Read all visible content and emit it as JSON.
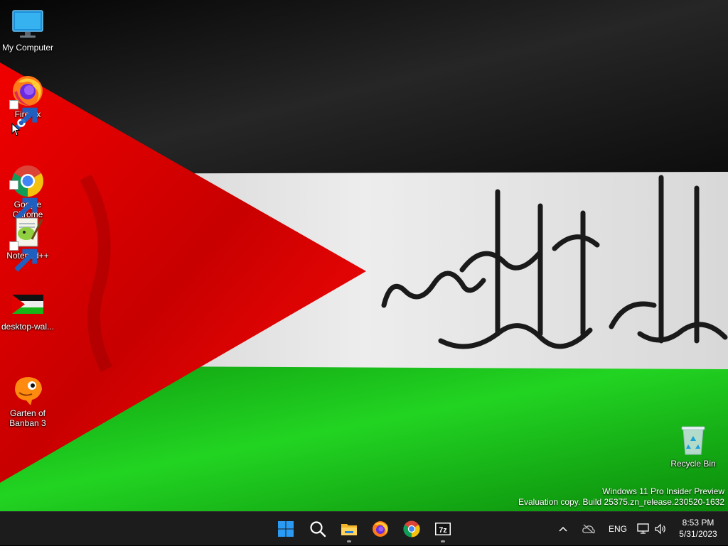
{
  "desktop": {
    "icons": [
      {
        "label": "My Computer",
        "icon": "monitor-icon"
      },
      {
        "label": "Firefox",
        "icon": "firefox-icon",
        "shortcut": true
      },
      {
        "label": "Google\nChrome",
        "icon": "chrome-icon",
        "shortcut": true
      },
      {
        "label": "Notepad++",
        "icon": "notepadpp-icon",
        "shortcut": true
      },
      {
        "label": "desktop-wal...",
        "icon": "image-file-icon"
      },
      {
        "label": "Garten of\nBanban 3",
        "icon": "game-icon"
      },
      {
        "label": "Recycle Bin",
        "icon": "recycle-bin-icon"
      }
    ],
    "watermark": {
      "line1": "Windows 11 Pro Insider Preview",
      "line2": "Evaluation copy. Build 25375.zn_release.230520-1632"
    }
  },
  "taskbar": {
    "apps": [
      {
        "name": "Start",
        "icon": "windows-logo-icon"
      },
      {
        "name": "Search",
        "icon": "search-icon"
      },
      {
        "name": "File Explorer",
        "icon": "folder-icon",
        "running": true
      },
      {
        "name": "Firefox",
        "icon": "firefox-icon"
      },
      {
        "name": "Google Chrome",
        "icon": "chrome-icon"
      },
      {
        "name": "7-Zip",
        "icon": "7zip-icon",
        "running": true
      }
    ],
    "tray": {
      "language": "ENG",
      "time": "8:53 PM",
      "date": "5/31/2023"
    }
  },
  "colors": {
    "flag_red": "#e00000",
    "flag_green": "#10c010",
    "flag_white": "#e6e6e6",
    "flag_black": "#111111",
    "taskbar_bg": "#1c1c1c"
  }
}
